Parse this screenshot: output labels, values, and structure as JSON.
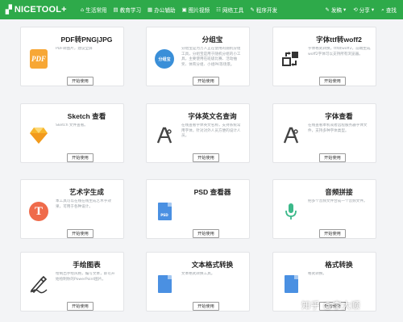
{
  "header": {
    "logo_text": "NICETOOL+",
    "nav": [
      {
        "icon": "home-icon",
        "glyph": "⌂",
        "label": "生活常用"
      },
      {
        "icon": "book-icon",
        "glyph": "▤",
        "label": "教育学习"
      },
      {
        "icon": "office-icon",
        "glyph": "▦",
        "label": "办公辅助"
      },
      {
        "icon": "image-icon",
        "glyph": "▣",
        "label": "图片视频"
      },
      {
        "icon": "network-icon",
        "glyph": "☷",
        "label": "网络工具"
      },
      {
        "icon": "code-icon",
        "glyph": "✎",
        "label": "程序开发"
      }
    ],
    "right": {
      "publish": "发稿",
      "share": "分享",
      "search": "查找"
    }
  },
  "tools": [
    {
      "title": "PDF转PNG|JPG",
      "desc": "PDF转图片，建议全屏",
      "button": "开始使用",
      "icon": "pdf-icon",
      "icon_text": "PDF",
      "color": "#f7a735"
    },
    {
      "title": "分组宝",
      "desc": "分组宝是为万人正在使用的随机分组工具，分组宝是用于随机分组的小工具，主要使用在班级比赛、活动抽奖、体育分组、小组PK等场景。",
      "button": "开始使用",
      "icon": "group-icon",
      "icon_text": "分组宝",
      "color": "#3a8fd8"
    },
    {
      "title": "字体ttf转woff2",
      "desc": "字体格式转换，ttf转woff2，前端生成woff2字体可以支持所有浏览器。",
      "button": "开始使用",
      "icon": "font-convert-icon",
      "color": "#333333"
    },
    {
      "title": "Sketch 查看",
      "desc": "Sketch 文件查看。",
      "button": "开始使用",
      "icon": "sketch-icon",
      "color": "#f7b52c"
    },
    {
      "title": "字体英文名查询",
      "desc": "在线查看字体英文名称，支持系统常用字体，针对对外人员方便的设计人员。",
      "button": "开始使用",
      "icon": "font-search-icon",
      "color": "#444444"
    },
    {
      "title": "字体查看",
      "desc": "在线查看本机或者远程服务器字体文件，支持多种字体类型。",
      "button": "开始使用",
      "icon": "font-view-icon",
      "color": "#444444"
    },
    {
      "title": "艺术字生成",
      "desc": "本工具可以在线在线生成艺术字效果，可用于各种设计。",
      "button": "开始使用",
      "icon": "art-text-icon",
      "icon_text": "T",
      "color": "#ef6b4b"
    },
    {
      "title": "PSD 查看器",
      "desc": "",
      "button": "开始使用",
      "icon": "psd-icon",
      "icon_text": "PSD",
      "color": "#4a90e2"
    },
    {
      "title": "音频拼接",
      "desc": "把多个音频文件合成一个音频文件。",
      "button": "开始使用",
      "icon": "mic-icon",
      "color": "#3cb98a"
    },
    {
      "title": "手绘图表",
      "desc": "绘制出手绘风格，编写文本，即可开始绘制你的PowerPoint图片。",
      "button": "开始使用",
      "icon": "hand-draw-icon",
      "color": "#333333"
    },
    {
      "title": "文本格式转换",
      "desc": "文本格式转换工具。",
      "button": "开始使用",
      "icon": "text-file-icon",
      "color": "#4a90e2"
    },
    {
      "title": "格式转换",
      "desc": "格式转换。",
      "button": "开始使用",
      "icon": "file-icon",
      "color": "#4a90e2"
    }
  ],
  "watermark": "知乎 @李大顺"
}
